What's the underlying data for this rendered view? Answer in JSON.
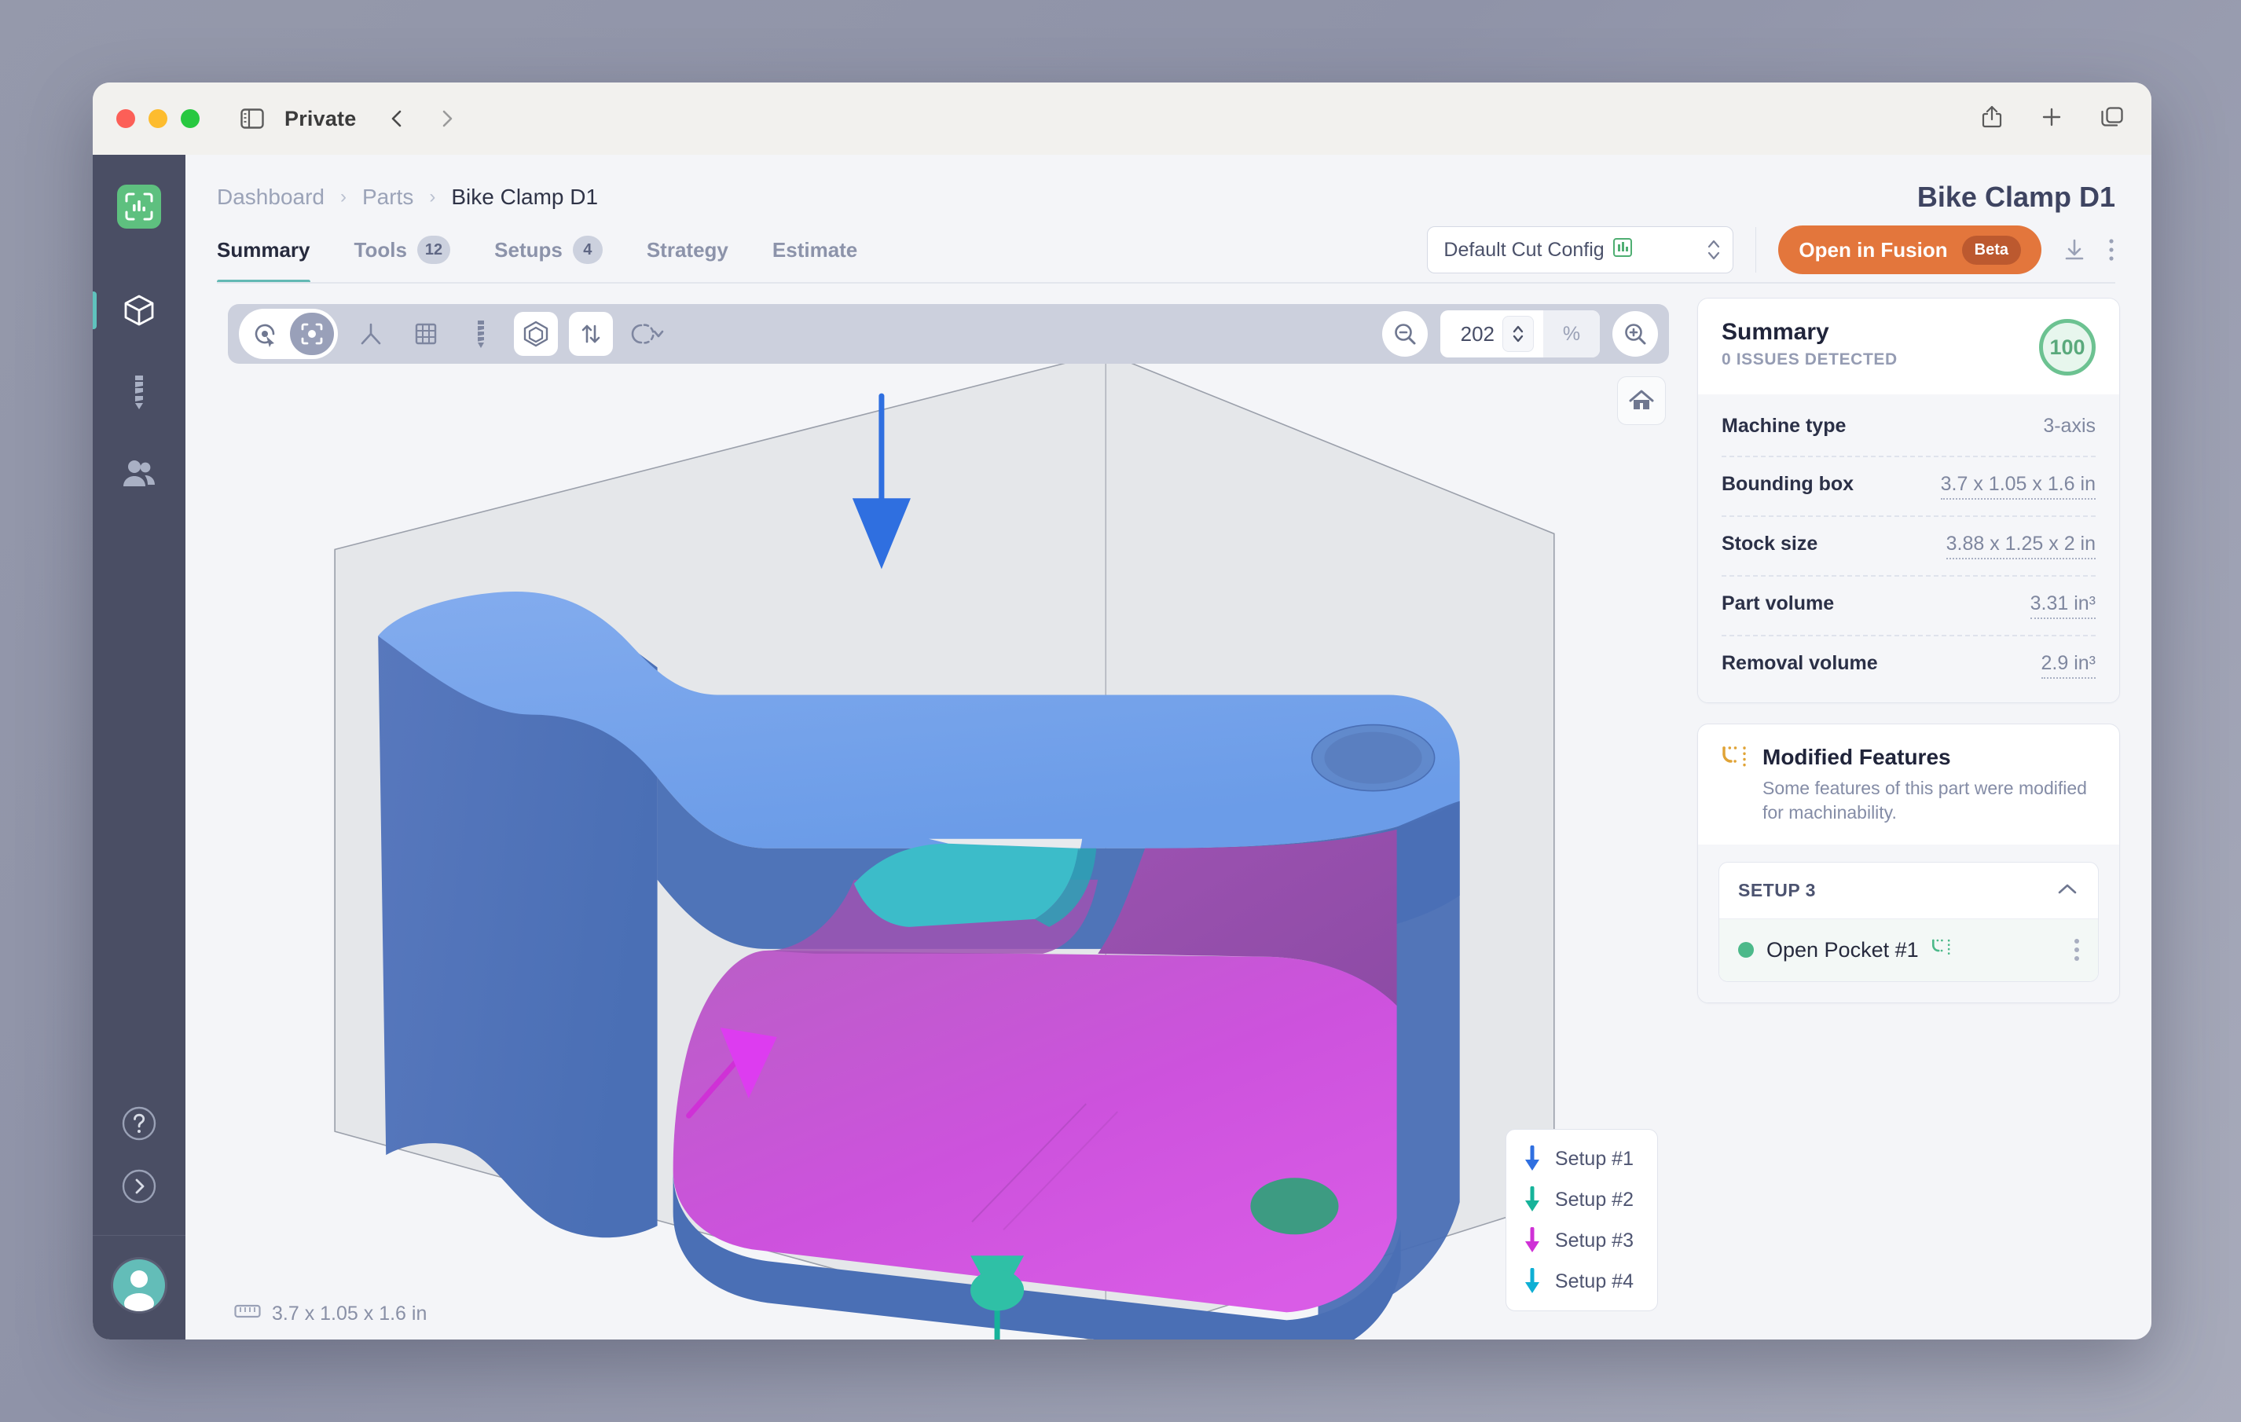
{
  "browser": {
    "window_label": "Private",
    "icons": {
      "sidebar_toggle": "sidebar-toggle-icon",
      "back": "back-chevron-icon",
      "forward": "forward-chevron-icon",
      "share": "share-icon",
      "new_tab": "plus-icon",
      "tabs": "tab-overview-icon"
    }
  },
  "rail": {
    "logo": "app-logo-icon",
    "items": [
      {
        "name": "parts",
        "icon": "cube-icon",
        "active": true
      },
      {
        "name": "tools",
        "icon": "drill-bit-icon",
        "active": false
      },
      {
        "name": "team",
        "icon": "people-icon",
        "active": false
      }
    ],
    "bottom": [
      {
        "name": "help",
        "icon": "question-circle-icon"
      },
      {
        "name": "expand",
        "icon": "chevron-right-circle-icon"
      }
    ],
    "avatar": "user-avatar"
  },
  "breadcrumb": {
    "items": [
      "Dashboard",
      "Parts",
      "Bike Clamp D1"
    ],
    "separator": "›"
  },
  "page": {
    "title": "Bike Clamp D1"
  },
  "tabs": [
    {
      "label": "Summary",
      "badge": null,
      "active": true
    },
    {
      "label": "Tools",
      "badge": "12",
      "active": false
    },
    {
      "label": "Setups",
      "badge": "4",
      "active": false
    },
    {
      "label": "Strategy",
      "badge": null,
      "active": false
    },
    {
      "label": "Estimate",
      "badge": null,
      "active": false
    }
  ],
  "toolbar_right": {
    "cut_config_value": "Default Cut Config",
    "cut_config_icon": "cut-config-icon",
    "fusion_button": "Open in Fusion",
    "fusion_badge": "Beta",
    "download_icon": "download-icon",
    "more_icon": "kebab-menu-icon"
  },
  "viewport": {
    "tools": [
      {
        "name": "select-orbit-tool",
        "icon": "cursor-orbit-icon",
        "active": false
      },
      {
        "name": "fit-view-tool",
        "icon": "frame-target-icon",
        "active": true
      },
      {
        "name": "axis-tool",
        "icon": "origin-axis-icon",
        "active": false
      },
      {
        "name": "grid-tool",
        "icon": "grid-icon",
        "active": false
      },
      {
        "name": "tool-path-tool",
        "icon": "drill-bit-icon",
        "active": false
      },
      {
        "name": "stock-visibility-tool",
        "icon": "cube-outline-icon",
        "active": true
      },
      {
        "name": "setup-arrows-tool",
        "icon": "arrows-up-down-icon",
        "active": true
      },
      {
        "name": "rotate-tool",
        "icon": "partial-circle-icon",
        "active": false
      }
    ],
    "zoom_out_icon": "zoom-out-icon",
    "zoom_in_icon": "zoom-in-icon",
    "zoom_value": "202",
    "zoom_unit": "%",
    "home_icon": "home-icon",
    "dimension_icon": "ruler-icon",
    "dimension_text": "3.7 x 1.05 x 1.6 in",
    "legend": [
      {
        "label": "Setup #1",
        "color": "#2f6fe0"
      },
      {
        "label": "Setup #2",
        "color": "#16b39a"
      },
      {
        "label": "Setup #3",
        "color": "#cf31d6"
      },
      {
        "label": "Setup #4",
        "color": "#0eafd4"
      }
    ]
  },
  "summary_card": {
    "title": "Summary",
    "subtitle": "0 ISSUES DETECTED",
    "score": "100",
    "score_color": "#6cc291",
    "rows": [
      {
        "key": "Machine type",
        "value": "3-axis",
        "dotted": false
      },
      {
        "key": "Bounding box",
        "value": "3.7 x 1.05 x 1.6 in",
        "dotted": true
      },
      {
        "key": "Stock size",
        "value": "3.88 x 1.25 x 2 in",
        "dotted": true
      },
      {
        "key": "Part volume",
        "value": "3.31 in³",
        "dotted": true
      },
      {
        "key": "Removal volume",
        "value": "2.9 in³",
        "dotted": true
      }
    ]
  },
  "modified_features": {
    "icon": "modified-feature-icon",
    "icon_color": "#e0a336",
    "title": "Modified Features",
    "description": "Some features of this part were modified for machinability.",
    "setup_label": "SETUP 3",
    "collapse_icon": "chevron-up-icon",
    "features": [
      {
        "name": "Open Pocket #1",
        "status_color": "#4cb98a",
        "badge_icon": "modified-feature-icon"
      }
    ]
  },
  "model_colors": {
    "stock": "#d8dade",
    "setup1_blue": "#6b9ce8",
    "setup1_blue_dark": "#4a6fb5",
    "setup3_magenta": "#d253e0",
    "setup3_magenta_dark": "#9a4fae",
    "setup4_teal": "#3cbcc9",
    "hole_green": "#3d9b82"
  }
}
